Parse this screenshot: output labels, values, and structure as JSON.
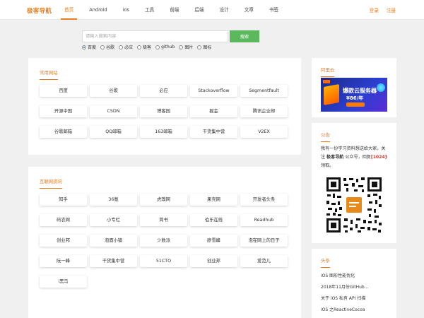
{
  "header": {
    "logo": "极客导航",
    "nav": [
      {
        "label": "首页",
        "active": true
      },
      {
        "label": "Android",
        "active": false
      },
      {
        "label": "ios",
        "active": false
      },
      {
        "label": "工具",
        "active": false
      },
      {
        "label": "前端",
        "active": false
      },
      {
        "label": "后端",
        "active": false
      },
      {
        "label": "设计",
        "active": false
      },
      {
        "label": "文章",
        "active": false
      },
      {
        "label": "书签",
        "active": false
      }
    ],
    "login": "登录",
    "register": "注册"
  },
  "search": {
    "placeholder": "请输入搜索内容",
    "button": "搜索",
    "engines": [
      {
        "label": "百度",
        "selected": true
      },
      {
        "label": "谷歌",
        "selected": false
      },
      {
        "label": "必应",
        "selected": false
      },
      {
        "label": "极客",
        "selected": false
      },
      {
        "label": "github",
        "selected": false
      },
      {
        "label": "图片",
        "selected": false
      },
      {
        "label": "图标",
        "selected": false
      }
    ]
  },
  "common_sites": {
    "title": "常用网站",
    "links": [
      "百度",
      "谷歌",
      "必应",
      "Stackoverflow",
      "Segmentfault",
      "开源中国",
      "CSDN",
      "博客园",
      "掘金",
      "腾讯企业邮",
      "谷歌邮箱",
      "QQ邮箱",
      "163邮箱",
      "干货集中营",
      "V2EX"
    ]
  },
  "it_news": {
    "title": "互联网资讯",
    "links": [
      "知乎",
      "36氪",
      "虎嗅网",
      "果壳网",
      "开发者头条",
      "码农网",
      "小专栏",
      "简书",
      "伯乐在线",
      "Readhub",
      "创业邦",
      "泡面小镇",
      "少数派",
      "廖雪峰",
      "泡在网上的日子",
      "阮一峰",
      "干货集中营",
      "51CTO",
      "创业邦",
      "爱范儿",
      "i黑马"
    ]
  },
  "sidebar": {
    "aliyun": {
      "title": "阿里云",
      "ad_main": "爆款云服务器",
      "ad_price": "¥86/年"
    },
    "notice": {
      "title": "公告",
      "text_1": "我有一份学习资料想送给大家，关注 ",
      "brand": "极客导航",
      "text_2": " 公众号，回复",
      "code": "[1024]",
      "text_3": "领取。"
    },
    "headlines": {
      "title": "头条",
      "items": [
        "iOS 图形性能优化",
        "2018年11月份GitHub...",
        "关于 iOS 私有 API 扫描",
        "iOS 之ReactiveCocoa"
      ]
    }
  },
  "colors": {
    "accent": "#e67e22",
    "search_button": "#5cb85c"
  }
}
